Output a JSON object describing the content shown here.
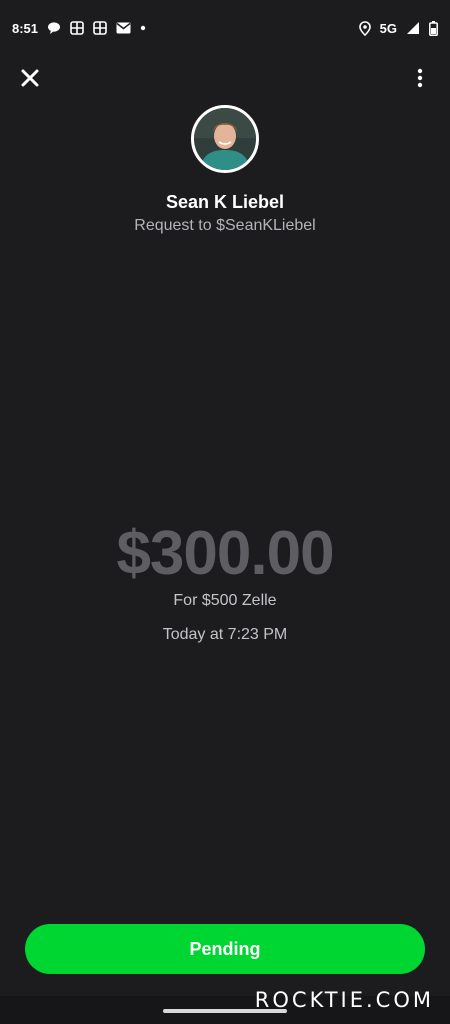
{
  "status_bar": {
    "time": "8:51",
    "network": "5G",
    "left_icons": [
      "chat-bubble-icon",
      "grid-app-icon",
      "grid-app-icon",
      "mail-icon",
      "dot-icon"
    ],
    "right_icons": [
      "location-icon",
      "signal-icon",
      "battery-icon"
    ]
  },
  "header": {
    "close_icon": "close-icon",
    "more_icon": "more-vertical-icon"
  },
  "recipient": {
    "name": "Sean K Liebel",
    "subtitle": "Request to $SeanKLiebel"
  },
  "payment": {
    "amount": "$300.00",
    "note": "For $500 Zelle",
    "time": "Today at 7:23 PM"
  },
  "action": {
    "button_label": "Pending"
  },
  "watermark": "ROCKTIE.COM",
  "colors": {
    "background": "#1c1c1e",
    "accent": "#00d632",
    "amount": "#5e5e62"
  }
}
